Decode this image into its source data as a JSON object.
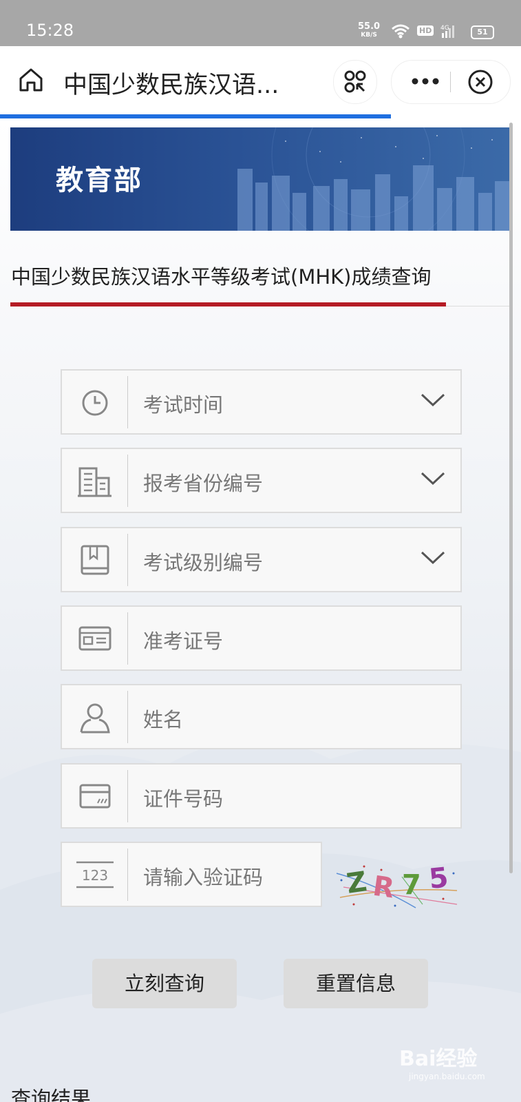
{
  "status_bar": {
    "time": "15:28",
    "net_speed": "55.0",
    "net_unit": "KB/S",
    "hd": "HD",
    "network": "4G",
    "battery": "51"
  },
  "nav_bar": {
    "title": "中国少数民族汉语...",
    "icons": [
      "home-icon",
      "scan-icon",
      "more-icon",
      "close-icon"
    ]
  },
  "banner": {
    "text": "教育部"
  },
  "page": {
    "title": "中国少数民族汉语水平等级考试(MHK)成绩查询"
  },
  "form": {
    "exam_time": {
      "placeholder": "考试时间",
      "icon": "clock-icon"
    },
    "province": {
      "placeholder": "报考省份编号",
      "icon": "building-icon"
    },
    "level": {
      "placeholder": "考试级别编号",
      "icon": "book-icon"
    },
    "ticket": {
      "placeholder": "准考证号",
      "icon": "id-card-icon"
    },
    "name": {
      "placeholder": "姓名",
      "icon": "user-icon"
    },
    "id_number": {
      "placeholder": "证件号码",
      "icon": "card-icon"
    },
    "captcha": {
      "placeholder": "请输入验证码",
      "icon": "number-123-icon",
      "image_text": "ZR75"
    }
  },
  "buttons": {
    "query": "立刻查询",
    "reset": "重置信息"
  },
  "results": {
    "heading": "查询结果"
  },
  "watermark": {
    "brand": "Bai经验",
    "url": "jingyan.baidu.com"
  },
  "colors": {
    "progress": "#1f6fe0",
    "title_underline": "#b51b24",
    "banner": "#2a5295",
    "button": "#dcdcdc"
  }
}
